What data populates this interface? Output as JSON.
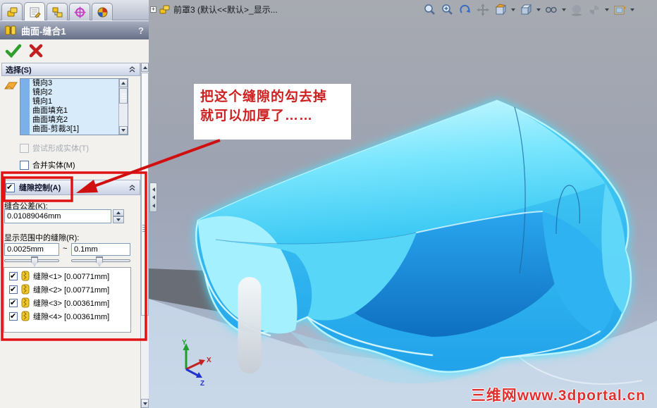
{
  "colors": {
    "annotation_red": "#e01212",
    "model_cyan": "#2ec8f4",
    "selection_stripe": "#7cb0e8",
    "panel_bg": "#f2f1ee"
  },
  "property_manager": {
    "tab_icons": [
      "featuremanager-tree",
      "propertymanager",
      "configurationmanager",
      "dimxpertmanager",
      "displaymanager"
    ],
    "title": "曲面-缝合1",
    "help_label": "?",
    "selection": {
      "header": "选择(S)",
      "items": [
        "镜向3",
        "镜向2",
        "镜向1",
        "曲面填充1",
        "曲面填充2",
        "曲面-剪裁3[1]"
      ],
      "try_form_solid": "尝试形成实体(T)",
      "merge_entities": "合并实体(M)"
    },
    "gap_control": {
      "header": "缝隙控制(A)",
      "enabled": true,
      "tolerance_label": "缝合公差(K):",
      "tolerance_value": "0.01089046mm",
      "range_label": "显示范围中的缝隙(R):",
      "range_min": "0.0025mm",
      "range_tilde": "~",
      "range_max": "0.1mm",
      "gaps": [
        {
          "label": "缝隙<1> [0.00771mm]",
          "checked": true
        },
        {
          "label": "缝隙<2> [0.00771mm]",
          "checked": true
        },
        {
          "label": "缝隙<3> [0.00361mm]",
          "checked": true
        },
        {
          "label": "缝隙<4> [0.00361mm]",
          "checked": true
        }
      ]
    }
  },
  "viewport": {
    "tree_expand_glyph": "+",
    "tree_label": "前罩3 (默认<<默认>_显示...",
    "view_toolbar_icons": [
      "zoom-to-fit",
      "zoom-to-area",
      "rotate-view",
      "pan",
      "section-view",
      "view-orientation",
      "display-style",
      "shadows",
      "appearances",
      "apply-scene"
    ],
    "annotation_line1": "把这个缝隙的勾去掉",
    "annotation_line2": "就可以加厚了……",
    "triad": {
      "x_label": "X",
      "y_label": "Y",
      "z_label": "Z"
    },
    "watermark": "三维网www.3dportal.cn"
  }
}
